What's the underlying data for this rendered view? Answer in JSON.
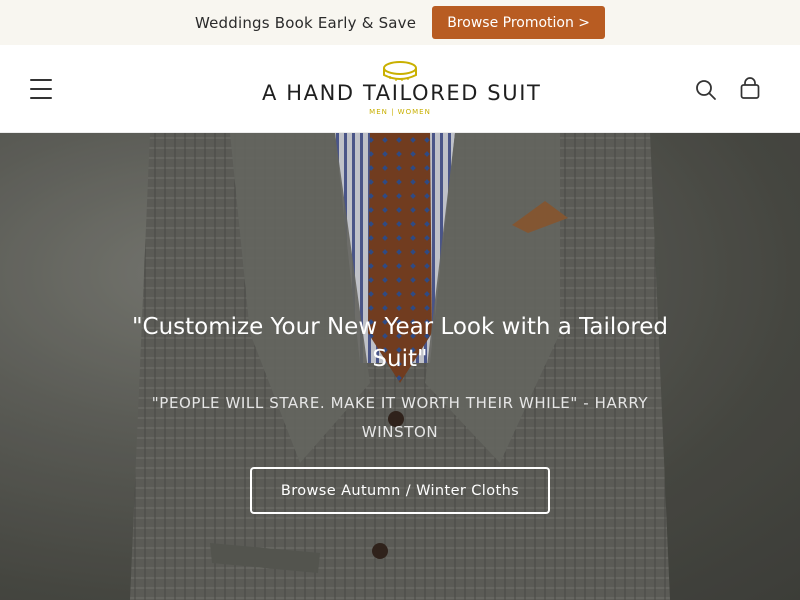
{
  "announcement": {
    "text": "Weddings Book Early & Save",
    "button_label": "Browse Promotion >"
  },
  "header": {
    "logo_text": "A HAND TAILORED SUIT",
    "logo_sub": "MEN | WOMEN",
    "icons": [
      "menu-icon",
      "search-icon",
      "cart-icon"
    ]
  },
  "hero": {
    "title": "\"Customize Your New Year Look with a Tailored Suit\"",
    "quote": "\"PEOPLE WILL STARE. MAKE IT WORTH THEIR WHILE\" - HARRY WINSTON",
    "button_label": "Browse Autumn / Winter Cloths"
  },
  "colors": {
    "promo_button": "#b85c22",
    "announcement_bg": "#f8f6f0",
    "logo_accent": "#c9b000"
  }
}
